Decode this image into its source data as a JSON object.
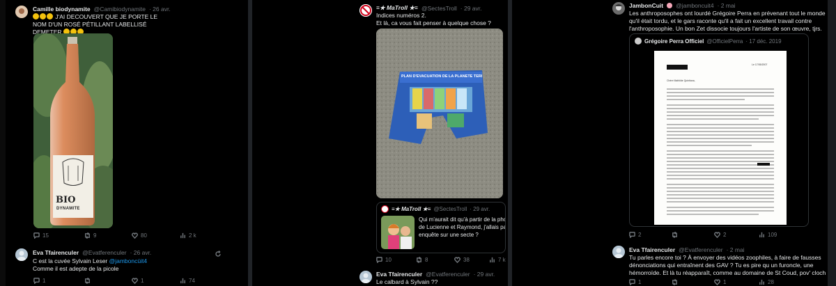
{
  "col1": {
    "tweet1": {
      "name": "Camille biodynamite",
      "handle": "@Camibiodynamite",
      "time": "· 26 avr.",
      "text": "J'AI DECOUVERT QUE JE PORTE LE NOM D'UN ROSÉ PÉTILLANT LABELLISÉ DEMETER",
      "label_top": "BIO",
      "label_bottom": "DYNAMITE",
      "replies": "15",
      "retweets": "9",
      "likes": "80",
      "views": "2 k"
    },
    "tweet2": {
      "name": "Eva Tfairenculer",
      "handle": "@Evatferenculer",
      "time": "· 26 avr.",
      "text_before": "C est la cuvée Sylvain Leser ",
      "mention": "@jamboncüit4",
      "text_line2": "Comme il est adepte de la picole",
      "replies": "1",
      "retweets": "",
      "likes": "1",
      "views": "74"
    }
  },
  "col2": {
    "tweet1": {
      "name": "≡★ MaTroll ★≡",
      "handle": "@SectesTroll",
      "time": "· 29 avr.",
      "text_line1": "Indices numéros 2.",
      "text_line2": "Et là, ca vous fait penser à quelque chose ?",
      "boxer_banner": "PLAN D'EVACUATION DE LA PLANETE TERRE",
      "quote": {
        "name": "≡★ MaTroll ★≡",
        "handle": "@SectesTroll",
        "time": "· 29 avr.",
        "line1": "Qui m'aurait dit qu'à partir de la photo d",
        "line2": "de Lucienne et Raymond, j'allais partir d",
        "line3": "enquête sur une secte ?"
      },
      "replies": "10",
      "retweets": "8",
      "likes": "38",
      "views": "7 k"
    },
    "tweet2": {
      "name": "Eva Tfairenculer",
      "handle": "@Evatferenculer",
      "time": "· 29 avr.",
      "text": "Le calbard à Sylvain ??"
    }
  },
  "col3": {
    "tweet1": {
      "name": "JambonCuit",
      "handle": "@jamboncuit4",
      "time": "· 2 mai",
      "text_line1": "Les anthroposophes ont lourdé Grégoire Perra en prévenant tout le monde",
      "text_line2": "qu'il était tordu, et le gars raconte qu'il a fait un excellent travail contre",
      "text_line3": "l'anthroposophie. Un bon Zet dissocie toujours l'artiste de son œuvre, tjrs.",
      "quote": {
        "name": "Grégoire Perra Officiel",
        "handle": "@OfficielPerra",
        "time": "· 17 déc. 2019",
        "doc_salutation": "Chère Mathilde Quintiana,",
        "doc_date": "Le 17/05/2007"
      },
      "replies": "2",
      "retweets": "",
      "likes": "2",
      "views": "109"
    },
    "tweet2": {
      "name": "Eva Tfairenculer",
      "handle": "@Evatferenculer",
      "time": "· 2 mai",
      "text_line1": "Tu parles encore toi ? À envoyer des vidéos zoophiles, à faire de fausses",
      "text_line2": "dénonciations qui entraînent des GAV ? Tu es pire qu un furoncle, une",
      "text_line3": "hémorroïde. Et là tu réapparaît, comme au domaine de St Coud, pov' cloche",
      "replies": "1",
      "retweets": "",
      "likes": "1",
      "views": "28"
    }
  },
  "icons": {
    "reply": "reply-icon",
    "retweet": "retweet-icon",
    "like": "heart-icon",
    "views": "views-icon",
    "thread": "thread-refresh-icon"
  },
  "colors": {
    "background": "#000000",
    "text": "#e7e9ea",
    "muted": "#71767b",
    "link": "#1d9bf0",
    "border": "#2f3336"
  }
}
